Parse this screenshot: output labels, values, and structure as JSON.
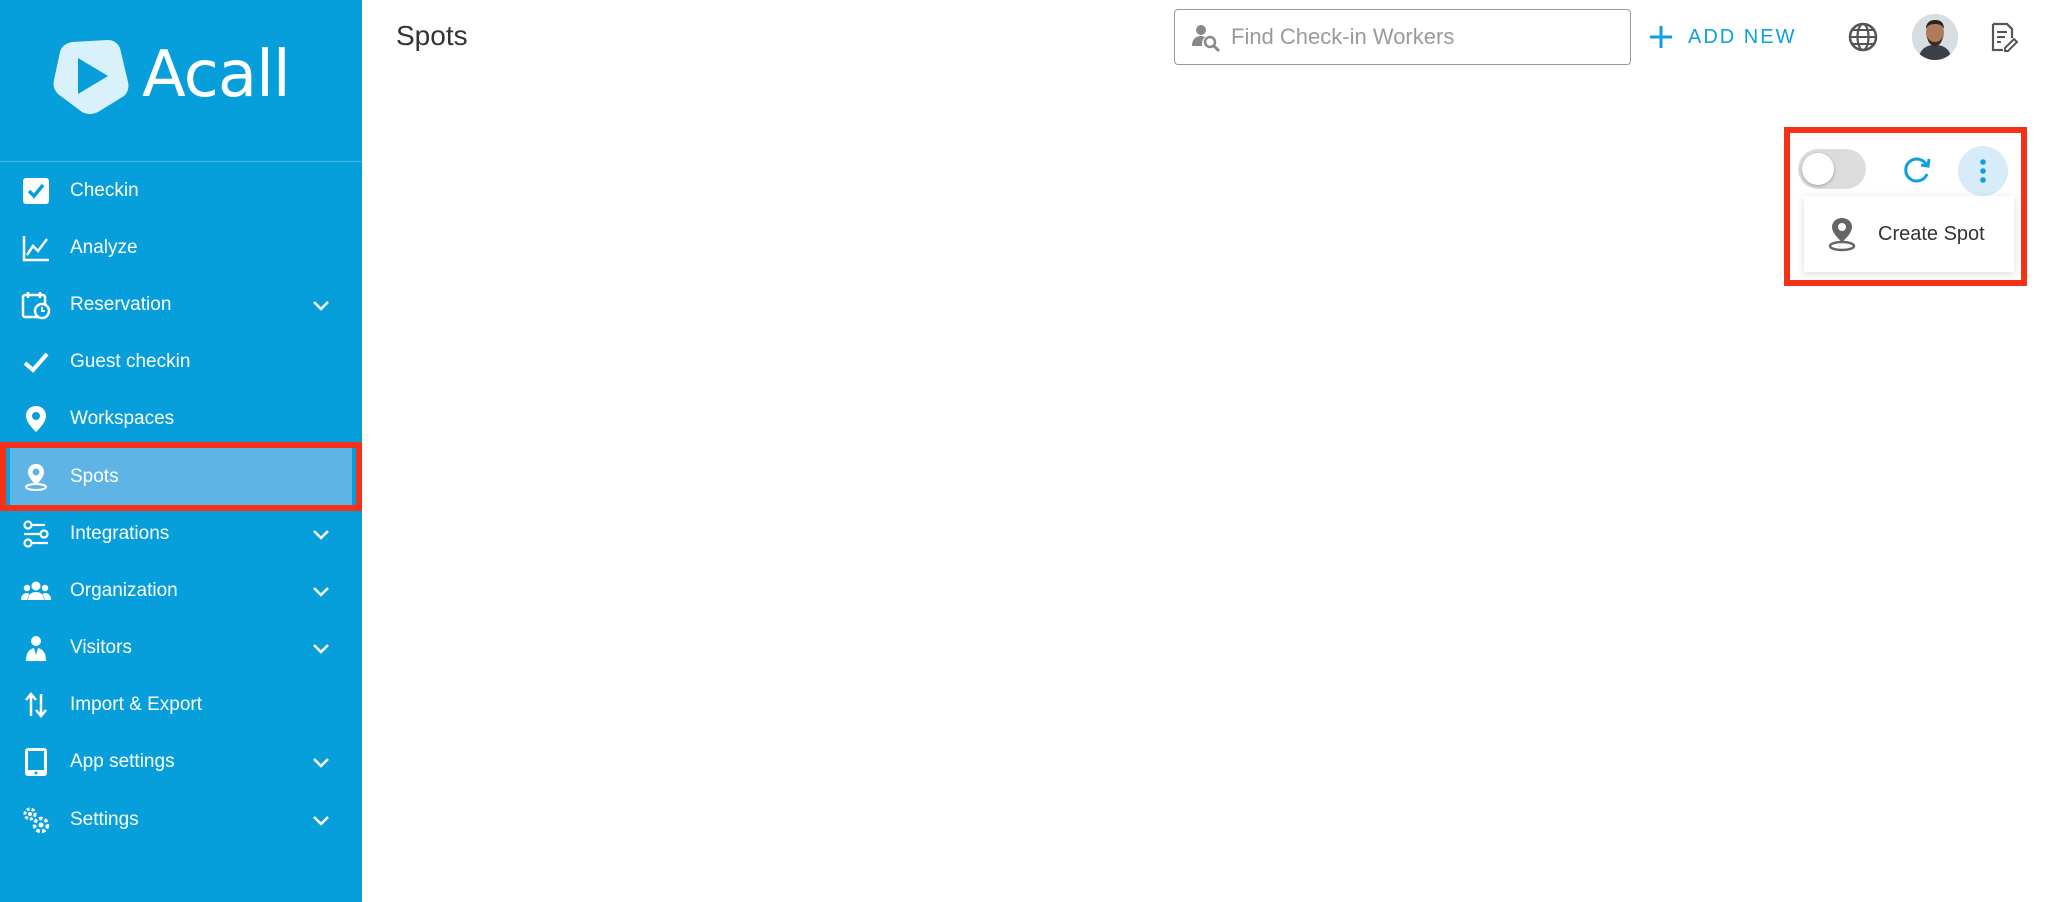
{
  "app": {
    "logo_text": "Acall",
    "page_title": "Spots"
  },
  "colors": {
    "sidebar": "#069fdc",
    "active_item": "#5fb4e6",
    "highlight": "#f4321a",
    "accent": "#0d9fdf"
  },
  "sidebar": {
    "items": [
      {
        "label": "Checkin",
        "icon": "checkbox-icon",
        "expandable": false
      },
      {
        "label": "Analyze",
        "icon": "line-chart-icon",
        "expandable": false
      },
      {
        "label": "Reservation",
        "icon": "calendar-clock-icon",
        "expandable": true
      },
      {
        "label": "Guest checkin",
        "icon": "checkmark-icon",
        "expandable": false
      },
      {
        "label": "Workspaces",
        "icon": "location-pin-icon",
        "expandable": false
      },
      {
        "label": "Spots",
        "icon": "spot-pin-icon",
        "expandable": false,
        "active": true
      },
      {
        "label": "Integrations",
        "icon": "integrations-icon",
        "expandable": true
      },
      {
        "label": "Organization",
        "icon": "people-icon",
        "expandable": true
      },
      {
        "label": "Visitors",
        "icon": "visitor-icon",
        "expandable": true
      },
      {
        "label": "Import & Export",
        "icon": "import-export-icon",
        "expandable": false
      },
      {
        "label": "App settings",
        "icon": "tablet-icon",
        "expandable": true
      },
      {
        "label": "Settings",
        "icon": "gears-icon",
        "expandable": true
      }
    ]
  },
  "header": {
    "search_placeholder": "Find Check-in Workers",
    "add_new_label": "ADD NEW"
  },
  "controls": {
    "toggle_on": false,
    "menu_item_label": "Create Spot"
  }
}
